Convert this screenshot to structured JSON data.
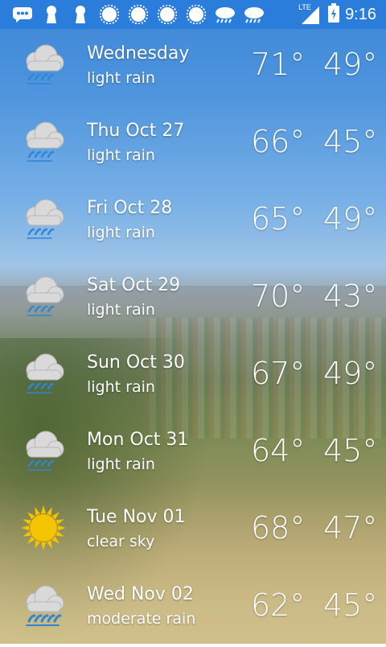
{
  "status_bar": {
    "notification_icons": [
      "message-icon",
      "keyhole-icon",
      "keyhole-icon",
      "sun-icon",
      "sun-icon",
      "sun-icon",
      "sun-icon",
      "rain-cloud-icon",
      "rain-cloud-icon"
    ],
    "network_label": "LTE",
    "time": "9:16"
  },
  "forecast": [
    {
      "day": "Wednesday",
      "condition": "light rain",
      "high": "71°",
      "low": "49°",
      "icon": "light-rain-icon"
    },
    {
      "day": "Thu Oct 27",
      "condition": "light rain",
      "high": "66°",
      "low": "45°",
      "icon": "light-rain-icon"
    },
    {
      "day": "Fri Oct 28",
      "condition": "light rain",
      "high": "65°",
      "low": "49°",
      "icon": "light-rain-icon"
    },
    {
      "day": "Sat Oct 29",
      "condition": "light rain",
      "high": "70°",
      "low": "43°",
      "icon": "light-rain-icon"
    },
    {
      "day": "Sun Oct 30",
      "condition": "light rain",
      "high": "67°",
      "low": "49°",
      "icon": "light-rain-icon"
    },
    {
      "day": "Mon Oct 31",
      "condition": "light rain",
      "high": "64°",
      "low": "45°",
      "icon": "light-rain-icon"
    },
    {
      "day": "Tue Nov 01",
      "condition": "clear sky",
      "high": "68°",
      "low": "47°",
      "icon": "sun-icon"
    },
    {
      "day": "Wed Nov 02",
      "condition": "moderate rain",
      "high": "62°",
      "low": "45°",
      "icon": "moderate-rain-icon"
    }
  ],
  "colors": {
    "status_bar": "#2b7ddc",
    "rain_drops": "#2f86d6",
    "sun": "#f5c400"
  }
}
